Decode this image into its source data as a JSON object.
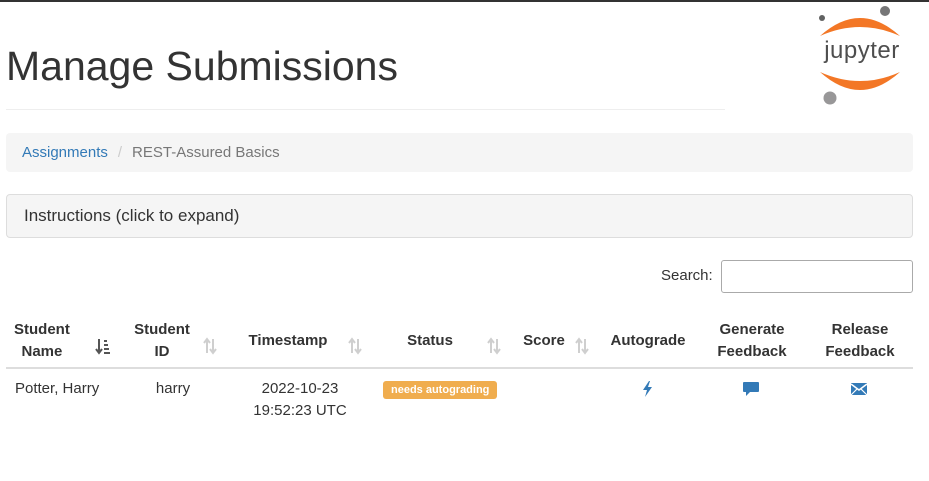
{
  "header": {
    "title": "Manage Submissions",
    "logo_text": "jupyter"
  },
  "breadcrumb": {
    "link": "Assignments",
    "separator": "/",
    "current": "REST-Assured Basics"
  },
  "instructions": {
    "label": "Instructions (click to expand)"
  },
  "search": {
    "label": "Search:",
    "value": ""
  },
  "table": {
    "columns": [
      {
        "line1": "Student",
        "line2": "Name"
      },
      {
        "line1": "Student",
        "line2": "ID"
      },
      {
        "line1": "Timestamp"
      },
      {
        "line1": "Status"
      },
      {
        "line1": "Score"
      },
      {
        "line1": "Autograde"
      },
      {
        "line1": "Generate",
        "line2": "Feedback"
      },
      {
        "line1": "Release",
        "line2": "Feedback"
      }
    ],
    "rows": [
      {
        "student_name": "Potter, Harry",
        "student_id": "harry",
        "timestamp_line1": "2022-10-23",
        "timestamp_line2": "19:52:23 UTC",
        "status": "needs autograding",
        "score": ""
      }
    ]
  },
  "icons": {
    "autograde": "bolt-icon",
    "generate_feedback": "comment-icon",
    "release_feedback": "envelope-icon",
    "sort_active": "sort-amount-desc-icon",
    "sort_inactive": "sort-icon"
  },
  "colors": {
    "link": "#337ab7",
    "badge_warning": "#f0ad4e",
    "action_icon": "#337ab7",
    "jupyter_orange": "#f37726"
  }
}
